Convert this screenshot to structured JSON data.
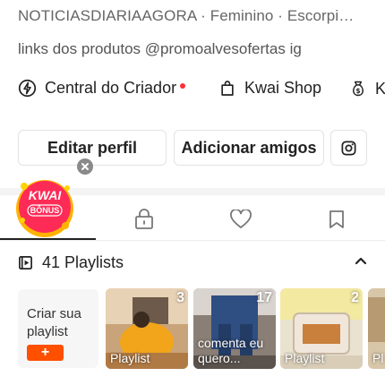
{
  "profile": {
    "meta": "NOTICIASDIARIAAGORA · Feminino · Escorpi…",
    "bio": "links dos produtos @promoalvesofertas ig"
  },
  "links": {
    "creator_center": "Central do Criador",
    "kwai_shop": "Kwai Shop",
    "partial": "K"
  },
  "actions": {
    "edit_profile": "Editar perfil",
    "add_friends": "Adicionar amigos"
  },
  "badge": {
    "line1": "KWAI",
    "line2": "BÔNUS"
  },
  "tabs": [
    {
      "icon": "kwai-bonus-badge",
      "active": true
    },
    {
      "icon": "lock-icon"
    },
    {
      "icon": "heart-icon"
    },
    {
      "icon": "bookmark-icon"
    }
  ],
  "playlists": {
    "header": "41 Playlists",
    "create_label": "Criar sua playlist",
    "create_button": "+",
    "items": [
      {
        "count": "3",
        "caption": "Playlist"
      },
      {
        "count": "17",
        "caption": "comenta eu quero..."
      },
      {
        "count": "2",
        "caption": "Playlist"
      },
      {
        "count": "",
        "caption": "Pl"
      }
    ]
  },
  "colors": {
    "accent": "#ff5000",
    "dot": "#ff2d3a"
  }
}
